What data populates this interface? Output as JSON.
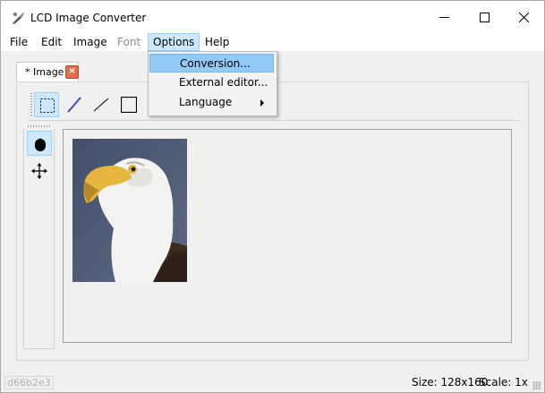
{
  "window": {
    "title": "LCD Image Converter"
  },
  "menubar": {
    "items": [
      {
        "label": "File",
        "state": "normal"
      },
      {
        "label": "Edit",
        "state": "normal"
      },
      {
        "label": "Image",
        "state": "normal"
      },
      {
        "label": "Font",
        "state": "disabled"
      },
      {
        "label": "Options",
        "state": "active"
      },
      {
        "label": "Help",
        "state": "normal"
      }
    ]
  },
  "options_menu": {
    "items": [
      {
        "label": "Conversion...",
        "highlighted": true
      },
      {
        "label": "External editor...",
        "highlighted": false
      },
      {
        "label": "Language",
        "has_submenu": true
      }
    ]
  },
  "document_tab": {
    "label": "* Image",
    "close_glyph": "×"
  },
  "toolbar": {
    "tools": [
      "select-rect-icon",
      "pen-icon",
      "line-icon",
      "rectangle-icon"
    ],
    "side_tools": [
      "fill-icon",
      "move-icon"
    ]
  },
  "status_bar": {
    "size": "Size: 128x160",
    "scale": "Scale: 1x",
    "hex": "d66b2e3"
  },
  "colors": {
    "menu_highlight": "#91c9f7",
    "active_menu": "#cce8ff",
    "tab_close": "#e46b4a"
  }
}
